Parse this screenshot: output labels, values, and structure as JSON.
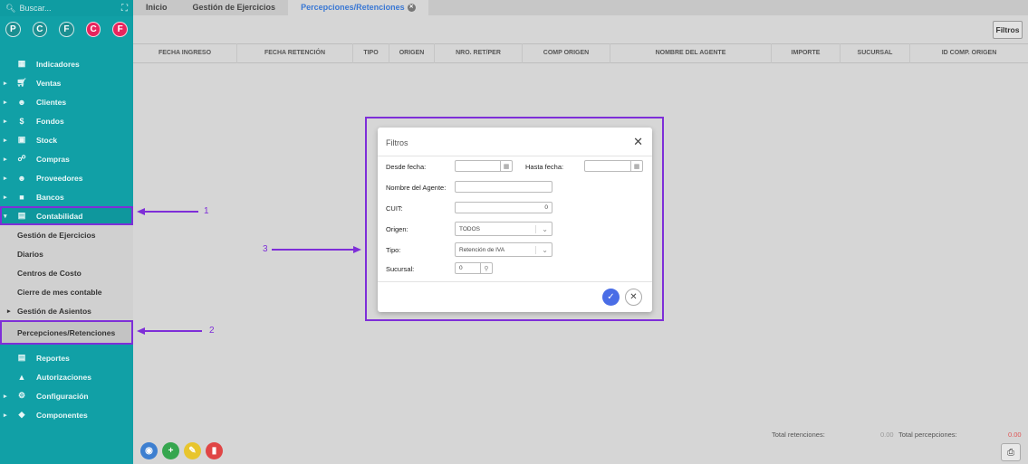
{
  "sidebar": {
    "search_placeholder": "Buscar...",
    "avatars": [
      {
        "letter": "P",
        "color": "#1b8f91"
      },
      {
        "letter": "C",
        "color": "#1b8f91"
      },
      {
        "letter": "F",
        "color": "#1b8f91"
      },
      {
        "letter": "C",
        "color": "#e8245d"
      },
      {
        "letter": "F",
        "color": "#e8245d"
      }
    ],
    "items": [
      {
        "label": "Indicadores",
        "icon": "dashboard-icon"
      },
      {
        "label": "Ventas",
        "icon": "cart-icon"
      },
      {
        "label": "Clientes",
        "icon": "people-icon"
      },
      {
        "label": "Fondos",
        "icon": "dollar-icon"
      },
      {
        "label": "Stock",
        "icon": "box-icon"
      },
      {
        "label": "Compras",
        "icon": "basket-icon"
      },
      {
        "label": "Proveedores",
        "icon": "people-icon"
      },
      {
        "label": "Bancos",
        "icon": "briefcase-icon"
      },
      {
        "label": "Contabilidad",
        "icon": "book-icon"
      }
    ],
    "subitems": [
      {
        "label": "Gestión de Ejercicios"
      },
      {
        "label": "Diarios"
      },
      {
        "label": "Centros de Costo"
      },
      {
        "label": "Cierre de mes contable"
      },
      {
        "label": "Gestión de Asientos"
      },
      {
        "label": "Percepciones/Retenciones"
      }
    ],
    "bottom_items": [
      {
        "label": "Reportes"
      },
      {
        "label": "Autorizaciones"
      },
      {
        "label": "Configuración"
      },
      {
        "label": "Componentes"
      }
    ]
  },
  "tabs": [
    "Inicio",
    "Gestión de Ejercicios",
    "Percepciones/Retenciones"
  ],
  "filtros_button": "Filtros",
  "table_headers": [
    "FECHA INGRESO",
    "FECHA RETENCIÓN",
    "TIPO",
    "ORIGEN",
    "NRO. RET/PER",
    "COMP ORIGEN",
    "NOMBRE DEL AGENTE",
    "IMPORTE",
    "SUCURSAL",
    "ID COMP. ORIGEN"
  ],
  "footer": {
    "total_retenciones_label": "Total retenciones:",
    "total_retenciones_value": "0.00",
    "total_percepciones_label": "Total percepciones:",
    "total_percepciones_value": "0.00"
  },
  "annotations": {
    "one": "1",
    "two": "2",
    "three": "3"
  },
  "modal": {
    "title": "Filtros",
    "desde_fecha_label": "Desde fecha:",
    "hasta_fecha_label": "Hasta fecha:",
    "nombre_agente_label": "Nombre del Agente:",
    "cuit_label": "CUIT:",
    "cuit_value": "0",
    "origen_label": "Origen:",
    "origen_value": "TODOS",
    "tipo_label": "Tipo:",
    "tipo_value": "Retención de IVA",
    "sucursal_label": "Sucursal:",
    "sucursal_value": "0"
  }
}
